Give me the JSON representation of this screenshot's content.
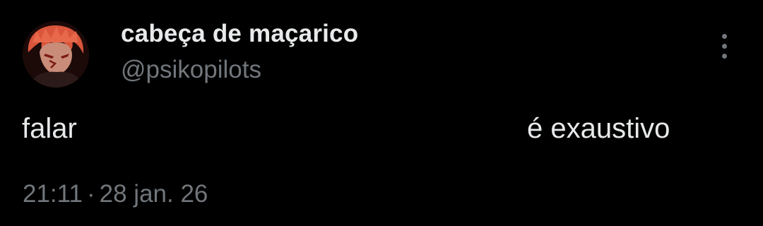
{
  "tweet": {
    "author": {
      "display_name": "cabeça de maçarico",
      "handle": "@psikopilots",
      "avatar_icon": "avatar-red-haired-character"
    },
    "more_icon": "more-vertical-icon",
    "text_before": "falar",
    "text_after": "é exaustivo",
    "time": "21:11",
    "separator": "·",
    "date": "28 jan. 26"
  },
  "colors": {
    "background": "#000000",
    "primary_text": "#e7e9ea",
    "secondary_text": "#71767b"
  }
}
